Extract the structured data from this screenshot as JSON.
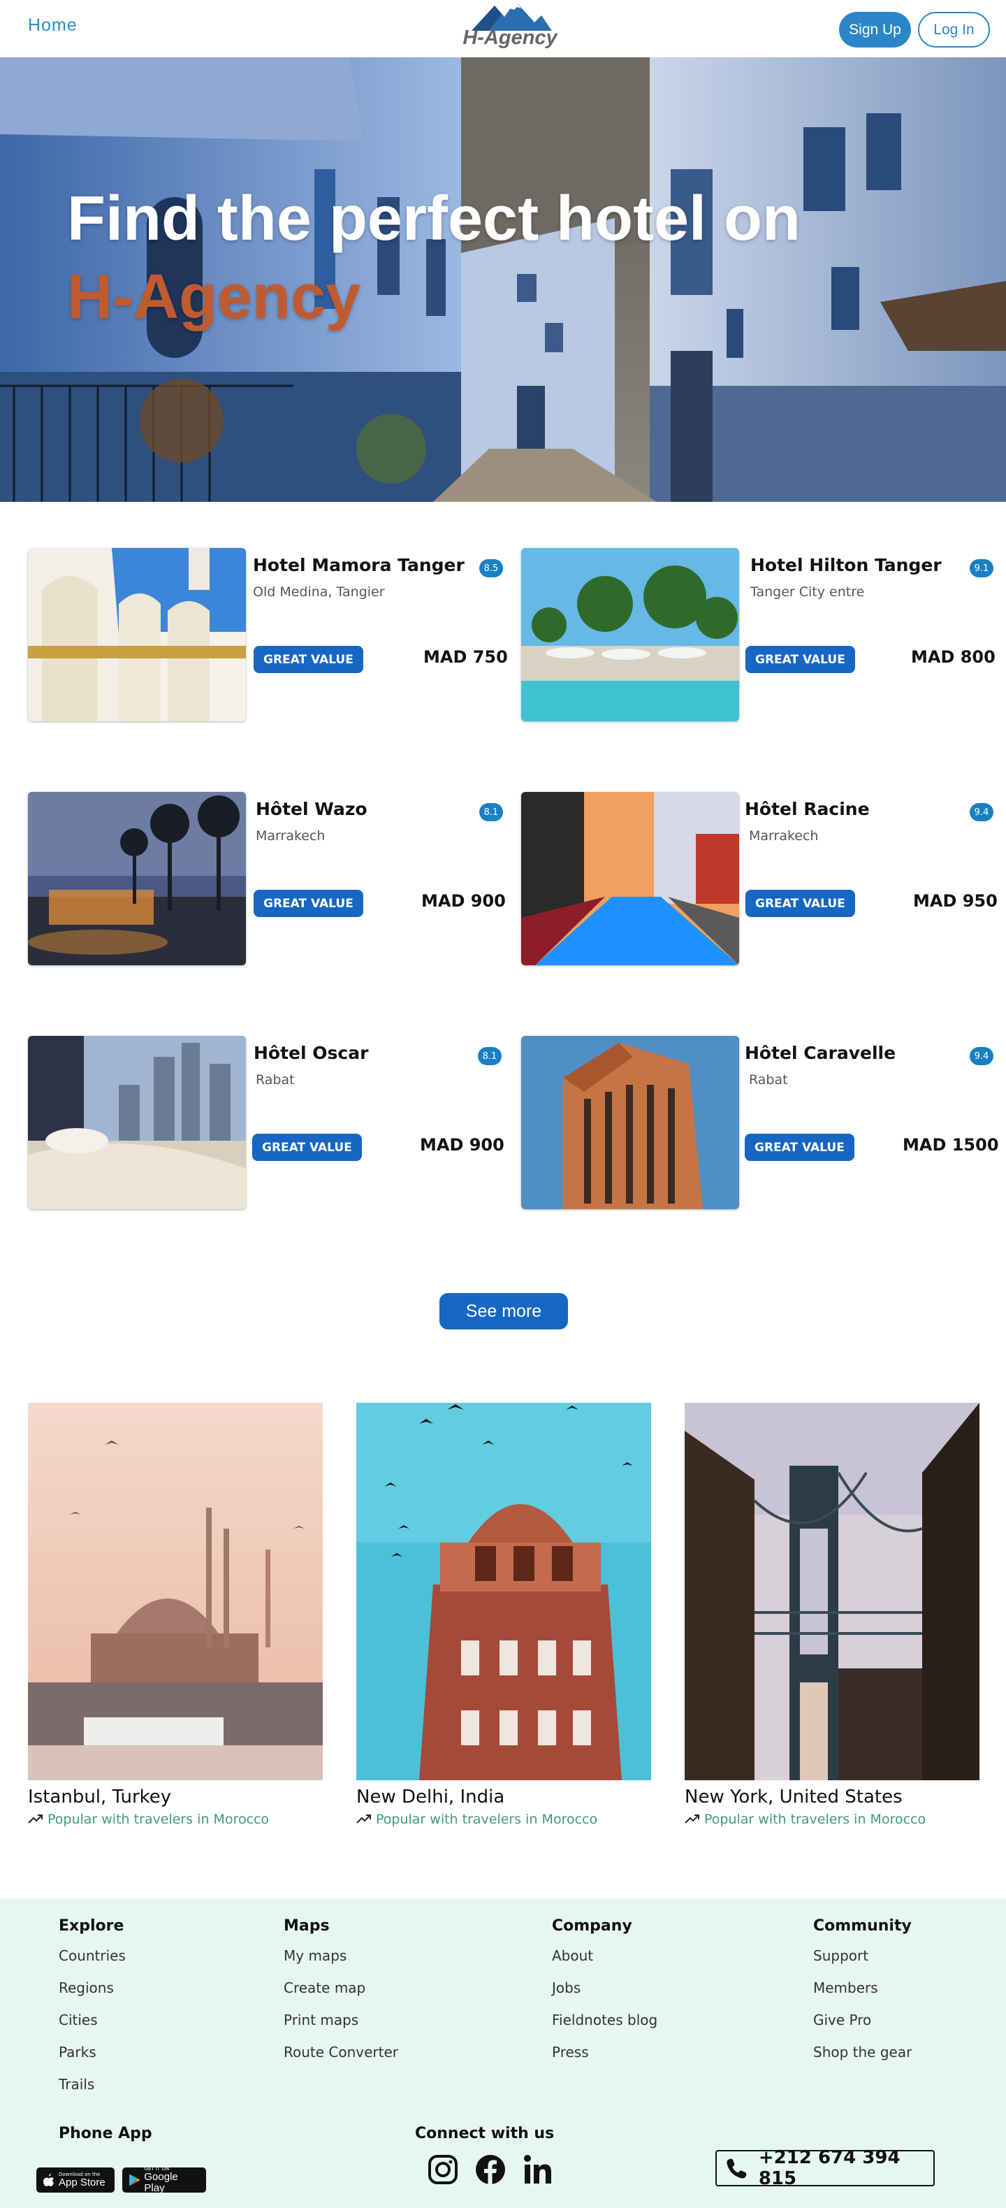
{
  "nav": {
    "home_label": "Home",
    "logo_text": "H-Agency",
    "signup_label": "Sign Up",
    "login_label": "Log In"
  },
  "hero": {
    "title": "Find the perfect hotel on",
    "brand": "H-Agency"
  },
  "hotels": [
    {
      "name": "Hotel Mamora Tanger",
      "location": "Old Medina, Tangier",
      "rating": "8.5",
      "badge": "GREAT VALUE",
      "price": "MAD 750"
    },
    {
      "name": "Hotel Hilton Tanger",
      "location": "Tanger City entre",
      "rating": "9.1",
      "badge": "GREAT VALUE",
      "price": "MAD 800"
    },
    {
      "name": "Hôtel Wazo",
      "location": "Marrakech",
      "rating": "8.1",
      "badge": "GREAT VALUE",
      "price": "MAD 900"
    },
    {
      "name": "Hôtel Racine",
      "location": "Marrakech",
      "rating": "9.4",
      "badge": "GREAT VALUE",
      "price": "MAD 950"
    },
    {
      "name": "Hôtel Oscar",
      "location": "Rabat",
      "rating": "8.1",
      "badge": "GREAT VALUE",
      "price": "MAD 900"
    },
    {
      "name": "Hôtel Caravelle",
      "location": "Rabat",
      "rating": "9.4",
      "badge": "GREAT VALUE",
      "price": "MAD 1500"
    }
  ],
  "see_more_label": "See more",
  "destinations": [
    {
      "title": "Istanbul, Turkey",
      "subtitle": "Popular with travelers in Morocco"
    },
    {
      "title": "New Delhi, India",
      "subtitle": "Popular with travelers in Morocco"
    },
    {
      "title": "New York, United States",
      "subtitle": "Popular with travelers in Morocco"
    }
  ],
  "footer": {
    "columns": [
      {
        "heading": "Explore",
        "links": [
          "Countries",
          "Regions",
          "Cities",
          "Parks",
          "Trails"
        ]
      },
      {
        "heading": "Maps",
        "links": [
          "My maps",
          "Create map",
          "Print maps",
          "Route Converter"
        ]
      },
      {
        "heading": "Company",
        "links": [
          "About",
          "Jobs",
          "Fieldnotes blog",
          "Press"
        ]
      },
      {
        "heading": "Community",
        "links": [
          "Support",
          "Members",
          "Give Pro",
          "Shop the gear"
        ]
      }
    ],
    "phone_app_title": "Phone App",
    "app_store": {
      "small": "Download on the",
      "big": "App Store"
    },
    "google_play": {
      "small": "GET IT ON",
      "big": "Google Play"
    },
    "connect_title": "Connect with us",
    "social_icons": [
      "instagram-icon",
      "facebook-icon",
      "linkedin-icon"
    ],
    "phone": "+212 674 394 815"
  },
  "colors": {
    "primary": "#1766c3",
    "nav_blue": "#2a86c8",
    "brand_orange": "#c05a30",
    "footer_bg": "#e6f7f3",
    "accent_green": "#3f9a7a"
  }
}
